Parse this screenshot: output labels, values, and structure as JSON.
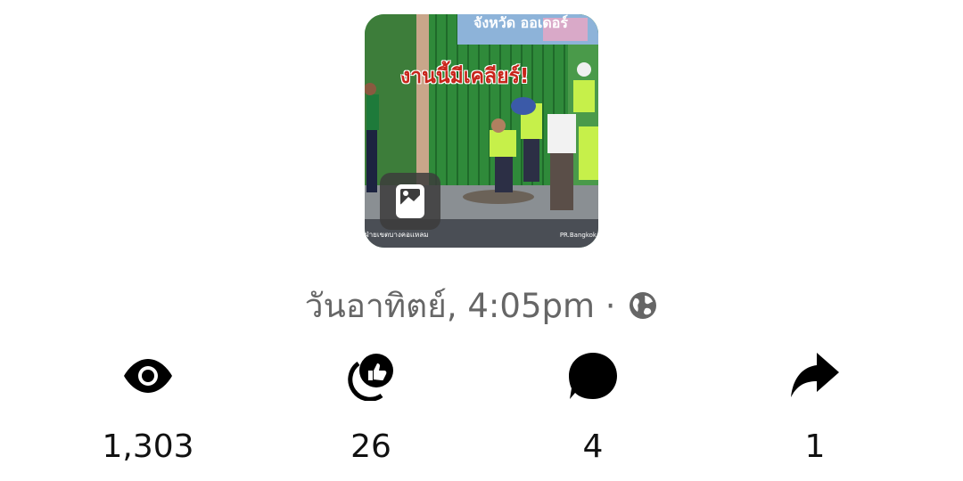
{
  "post": {
    "thumbnail": {
      "headline": "งานนี้มีเคลียร์!",
      "banner": "จังหวัด ออเดอร์",
      "credit_left": "ฝ่ายเขตบางคอแหลม",
      "credit_right": "PR.Bangkok",
      "badge_icon": "photo-icon"
    },
    "meta": {
      "day": "วันอาทิตย์",
      "time": "4:05pm",
      "separator": "·",
      "audience_icon": "globe-icon"
    }
  },
  "stats": [
    {
      "icon": "eye-icon",
      "value": "1,303"
    },
    {
      "icon": "reactions-icon",
      "value": "26"
    },
    {
      "icon": "comment-icon",
      "value": "4"
    },
    {
      "icon": "share-icon",
      "value": "1"
    }
  ],
  "colors": {
    "text_primary": "#111111",
    "text_secondary": "#666666",
    "headline_red": "#c8251b"
  }
}
